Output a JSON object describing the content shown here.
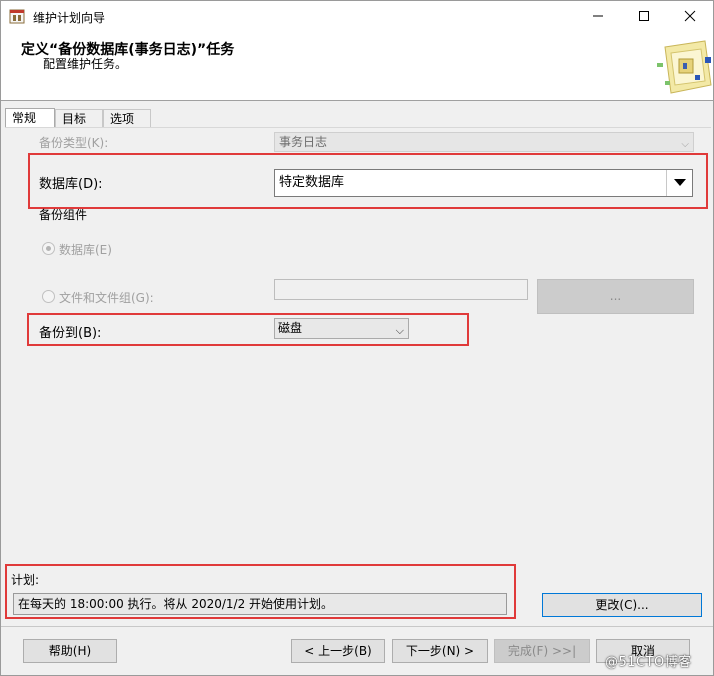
{
  "titlebar": {
    "title": "维护计划向导",
    "minimize": "—",
    "maximize": "☐",
    "close": "✕"
  },
  "header": {
    "title": "定义“备份数据库(事务日志)”任务",
    "subtitle": "配置维护任务。"
  },
  "tabs": [
    {
      "label": "常规",
      "active": true
    },
    {
      "label": "目标",
      "active": false
    },
    {
      "label": "选项",
      "active": false
    }
  ],
  "form": {
    "backup_type_label": "备份类型(K):",
    "backup_type_value": "事务日志",
    "database_label": "数据库(D):",
    "database_value": "特定数据库",
    "backup_component_label": "备份组件",
    "radio_database_label": "数据库(E)",
    "radio_files_label": "文件和文件组(G):",
    "browse_button": "...",
    "backup_to_label": "备份到(B):",
    "backup_to_value": "磁盘"
  },
  "schedule": {
    "label": "计划:",
    "value": "在每天的 18:00:00 执行。将从 2020/1/2 开始使用计划。",
    "change_button": "更改(C)..."
  },
  "footer": {
    "help": "帮助(H)",
    "back": "< 上一步(B)",
    "next": "下一步(N) >",
    "finish": "完成(F) >>|",
    "cancel": "取消"
  },
  "watermark": "@51CTO博客",
  "colors": {
    "highlight_border": "#e03a3a",
    "window_bg": "#f0f0f0"
  }
}
